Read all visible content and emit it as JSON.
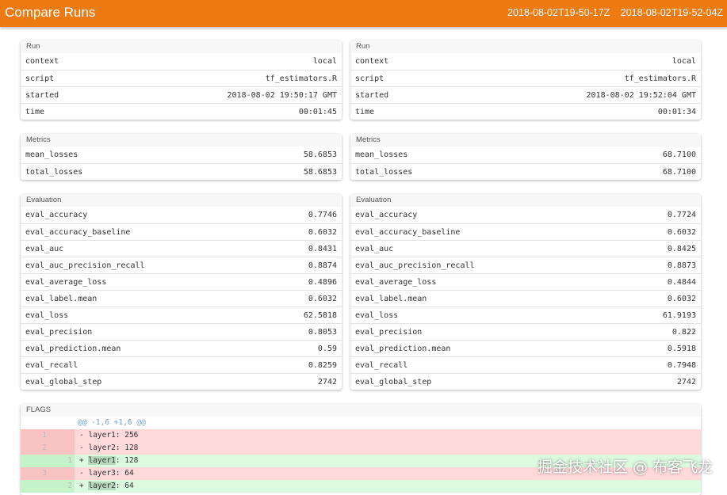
{
  "header": {
    "title": "Compare Runs",
    "run_a": "2018-08-02T19-50-17Z",
    "run_b": "2018-08-02T19-52-04Z"
  },
  "colors": {
    "accent": "#ee7a12",
    "diff_del": "#fdd9d9",
    "diff_add": "#dcfadf"
  },
  "left": {
    "run": {
      "title": "Run",
      "rows": [
        {
          "k": "context",
          "v": "local"
        },
        {
          "k": "script",
          "v": "tf_estimators.R"
        },
        {
          "k": "started",
          "v": "2018-08-02 19:50:17 GMT"
        },
        {
          "k": "time",
          "v": "00:01:45"
        }
      ]
    },
    "metrics": {
      "title": "Metrics",
      "rows": [
        {
          "k": "mean_losses",
          "v": "58.6853"
        },
        {
          "k": "total_losses",
          "v": "58.6853"
        }
      ]
    },
    "evaluation": {
      "title": "Evaluation",
      "rows": [
        {
          "k": "eval_accuracy",
          "v": "0.7746"
        },
        {
          "k": "eval_accuracy_baseline",
          "v": "0.6032"
        },
        {
          "k": "eval_auc",
          "v": "0.8431"
        },
        {
          "k": "eval_auc_precision_recall",
          "v": "0.8874"
        },
        {
          "k": "eval_average_loss",
          "v": "0.4896"
        },
        {
          "k": "eval_label.mean",
          "v": "0.6032"
        },
        {
          "k": "eval_loss",
          "v": "62.5818"
        },
        {
          "k": "eval_precision",
          "v": "0.8053"
        },
        {
          "k": "eval_prediction.mean",
          "v": "0.59"
        },
        {
          "k": "eval_recall",
          "v": "0.8259"
        },
        {
          "k": "eval_global_step",
          "v": "2742"
        }
      ]
    }
  },
  "right": {
    "run": {
      "title": "Run",
      "rows": [
        {
          "k": "context",
          "v": "local"
        },
        {
          "k": "script",
          "v": "tf_estimators.R"
        },
        {
          "k": "started",
          "v": "2018-08-02 19:52:04 GMT"
        },
        {
          "k": "time",
          "v": "00:01:34"
        }
      ]
    },
    "metrics": {
      "title": "Metrics",
      "rows": [
        {
          "k": "mean_losses",
          "v": "68.7100"
        },
        {
          "k": "total_losses",
          "v": "68.7100"
        }
      ]
    },
    "evaluation": {
      "title": "Evaluation",
      "rows": [
        {
          "k": "eval_accuracy",
          "v": "0.7724"
        },
        {
          "k": "eval_accuracy_baseline",
          "v": "0.6032"
        },
        {
          "k": "eval_auc",
          "v": "0.8425"
        },
        {
          "k": "eval_auc_precision_recall",
          "v": "0.8873"
        },
        {
          "k": "eval_average_loss",
          "v": "0.4844"
        },
        {
          "k": "eval_label.mean",
          "v": "0.6032"
        },
        {
          "k": "eval_loss",
          "v": "61.9193"
        },
        {
          "k": "eval_precision",
          "v": "0.822"
        },
        {
          "k": "eval_prediction.mean",
          "v": "0.5918"
        },
        {
          "k": "eval_recall",
          "v": "0.7948"
        },
        {
          "k": "eval_global_step",
          "v": "2742"
        }
      ]
    }
  },
  "flags": {
    "title": "FLAGS",
    "hunk": "@@ -1,6 +1,6 @@",
    "lines": [
      {
        "type": "del",
        "old": "1",
        "new": "",
        "sign": "-",
        "text": "layer1: 256",
        "hl": ""
      },
      {
        "type": "del",
        "old": "2",
        "new": "",
        "sign": "-",
        "text": "layer2: 128",
        "hl": ""
      },
      {
        "type": "add",
        "old": "",
        "new": "1",
        "sign": "+",
        "text": ": 128",
        "hl": "layer1"
      },
      {
        "type": "del",
        "old": "3",
        "new": "",
        "sign": "-",
        "text": "layer3: 64",
        "hl": ""
      },
      {
        "type": "add",
        "old": "",
        "new": "2",
        "sign": "+",
        "text": ": 64",
        "hl": "layer2"
      }
    ]
  },
  "watermark": "掘金技术社区 @ 布客飞龙"
}
